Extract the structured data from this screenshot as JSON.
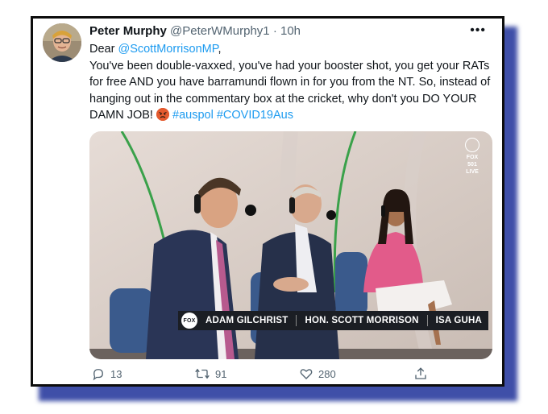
{
  "tweet": {
    "display_name": "Peter Murphy",
    "handle": "@PeterWMurphy1",
    "separator": "·",
    "time": "10h",
    "more_label": "•••",
    "line1_prefix": "Dear ",
    "mention": "@ScottMorrisonMP",
    "line1_suffix": ",",
    "text": "You've been double-vaxxed, you've had your booster shot, you get your RATs for free AND you have barramundi flown in for you from the NT. So, instead of hanging out in the commentary box at the cricket, why don't you DO YOUR DAMN JOB!",
    "hashtag1": "#auspol",
    "hashtag2": "#COVID19Aus",
    "emoji": "angry-face-emoji"
  },
  "media": {
    "channel_logo": "FOX 501 LIVE",
    "caption_logo": "FOX",
    "names": [
      "ADAM GILCHRIST",
      "HON. SCOTT MORRISON",
      "ISA GUHA"
    ]
  },
  "actions": {
    "replies": "13",
    "retweets": "91",
    "likes": "280"
  },
  "colors": {
    "link": "#1d9bf0",
    "text": "#0f1419",
    "muted": "#536471",
    "frame_shadow": "#3f4fa8"
  }
}
